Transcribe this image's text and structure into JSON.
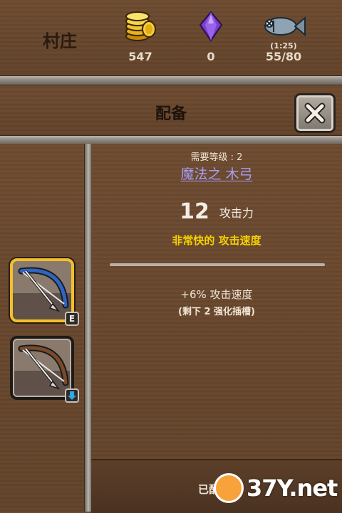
{
  "header": {
    "village_label": "村庄",
    "resources": [
      {
        "icon": "gold-coins-icon",
        "value": "547"
      },
      {
        "icon": "purple-gem-icon",
        "value": "0"
      },
      {
        "icon": "fish-icon",
        "value": "55/80",
        "timer": "(1:25)"
      }
    ]
  },
  "panel": {
    "title": "配备",
    "close_icon": "close-x-icon"
  },
  "inventory": {
    "slots": [
      {
        "icon": "blue-bow-icon",
        "badge": "E",
        "selected": true
      },
      {
        "icon": "wooden-bow-icon",
        "badge_icon": "down-arrow-icon",
        "selected": false
      }
    ]
  },
  "item": {
    "requirement": "需要等级 : 2",
    "name": "魔法之 木弓",
    "attack_value": "12",
    "attack_label": "攻击力",
    "speed": "非常快的 攻击速度",
    "bonus": "+6% 攻击速度",
    "slots_remaining": "(剩下 2 强化插槽)"
  },
  "footer": {
    "status_label": "已配备"
  },
  "watermark": {
    "text": "37Y.net"
  },
  "colors": {
    "item_name": "#a79cf4",
    "speed_text": "#f4d000",
    "selected_border": "#f1c02a"
  }
}
